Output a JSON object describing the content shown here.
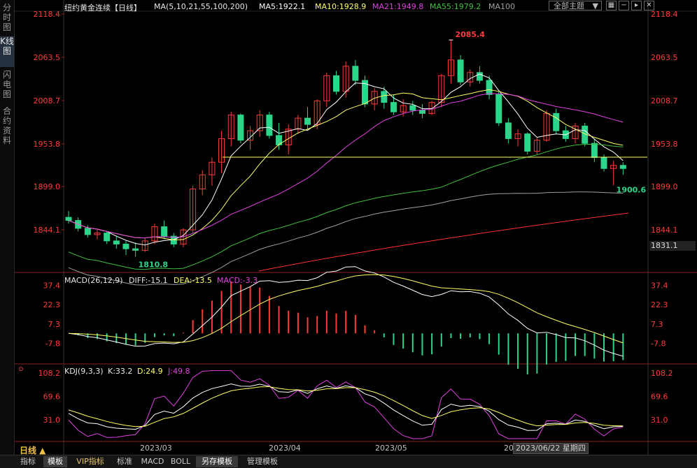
{
  "sidebar": {
    "tabs": [
      "分时图",
      "K线图",
      "闪电图",
      "合约资料"
    ],
    "active": 1
  },
  "header": {
    "title": "纽约黄金连续【日线】",
    "ma_label": "MA(5,10,21,55,100,200)",
    "ma5": "MA5:1922.1",
    "ma10": "MA10:1928.9",
    "ma21": "MA21:1949.8",
    "ma55": "MA55:1979.2",
    "ma100": "MA100",
    "theme_button": "全部主题"
  },
  "colors": {
    "up": "#ff3a3a",
    "down": "#2bd58a",
    "ma5": "#ffffff",
    "ma10": "#ffff66",
    "ma21": "#e040e0",
    "ma55": "#40c040",
    "ma100": "#a0a0a0",
    "ma200": "#ff3030",
    "axis_red": "#ff3a3a",
    "axis_green": "#2bd58a"
  },
  "price_axis": {
    "left_labels": [
      "2118.4",
      "2063.5",
      "2008.7",
      "1953.8",
      "1899.0",
      "1844.1"
    ],
    "right_labels": [
      "2118.4",
      "2063.5",
      "2008.7",
      "1953.8",
      "1899.0",
      "1844.1"
    ],
    "current_price": "1831.1"
  },
  "annotations": {
    "high": "2085.4",
    "low_march": "1810.8",
    "low_june": "1900.6"
  },
  "macd": {
    "label": "MACD(26,12,9)",
    "diff": "DIFF:-15.1",
    "dea": "DEA:-13.5",
    "macd": "MACD:-3.3",
    "labels": [
      "37.4",
      "22.3",
      "7.3",
      "-7.8"
    ]
  },
  "kdj": {
    "label": "KDJ(9,3,3)",
    "k": "K:33.2",
    "d": "D:24.9",
    "j": "J:49.8",
    "labels": [
      "108.2",
      "69.6",
      "31.0"
    ]
  },
  "x_axis": {
    "labels": [
      "2023/03",
      "2023/04",
      "2023/05",
      "20"
    ],
    "date_tip": "2023/06/22 星期四"
  },
  "period_tab": "日线 ▲",
  "bottom_tabs": [
    "指标",
    "模板",
    "VIP指标",
    "标准",
    "MACD",
    "BOLL",
    "另存模板",
    "管理模板"
  ],
  "chart_data": {
    "type": "candlestick",
    "title": "纽约黄金连续【日线】",
    "ylim": [
      1810,
      2120
    ],
    "candles_ohlc_approx": [
      [
        1860,
        1868,
        1852,
        1856
      ],
      [
        1856,
        1860,
        1842,
        1846
      ],
      [
        1846,
        1850,
        1834,
        1838
      ],
      [
        1838,
        1844,
        1832,
        1840
      ],
      [
        1840,
        1842,
        1826,
        1830
      ],
      [
        1830,
        1836,
        1820,
        1826
      ],
      [
        1826,
        1830,
        1812,
        1820
      ],
      [
        1820,
        1828,
        1810,
        1818
      ],
      [
        1818,
        1834,
        1816,
        1830
      ],
      [
        1830,
        1852,
        1826,
        1848
      ],
      [
        1848,
        1856,
        1832,
        1836
      ],
      [
        1836,
        1840,
        1822,
        1826
      ],
      [
        1826,
        1846,
        1822,
        1844
      ],
      [
        1844,
        1900,
        1840,
        1896
      ],
      [
        1896,
        1920,
        1888,
        1914
      ],
      [
        1914,
        1936,
        1900,
        1930
      ],
      [
        1930,
        1970,
        1916,
        1960
      ],
      [
        1960,
        1994,
        1950,
        1990
      ],
      [
        1990,
        1992,
        1954,
        1958
      ],
      [
        1958,
        1976,
        1946,
        1970
      ],
      [
        1970,
        1996,
        1962,
        1990
      ],
      [
        1990,
        1994,
        1960,
        1964
      ],
      [
        1964,
        1980,
        1946,
        1952
      ],
      [
        1952,
        1978,
        1940,
        1972
      ],
      [
        1972,
        1990,
        1966,
        1986
      ],
      [
        1986,
        2000,
        1972,
        1978
      ],
      [
        1978,
        2010,
        1972,
        2008
      ],
      [
        2008,
        2044,
        2000,
        2040
      ],
      [
        2040,
        2046,
        2016,
        2020
      ],
      [
        2020,
        2058,
        2012,
        2052
      ],
      [
        2052,
        2060,
        2028,
        2034
      ],
      [
        2034,
        2040,
        2000,
        2004
      ],
      [
        2004,
        2024,
        1996,
        2020
      ],
      [
        2020,
        2026,
        1998,
        2006
      ],
      [
        2006,
        2016,
        1990,
        1994
      ],
      [
        1994,
        2010,
        1988,
        2002
      ],
      [
        2002,
        2008,
        1990,
        1996
      ],
      [
        1996,
        2004,
        1986,
        1992
      ],
      [
        1992,
        2008,
        1990,
        2006
      ],
      [
        2006,
        2042,
        2000,
        2040
      ],
      [
        2040,
        2085.4,
        2030,
        2060
      ],
      [
        2060,
        2066,
        2028,
        2032
      ],
      [
        2032,
        2048,
        2026,
        2044
      ],
      [
        2044,
        2052,
        2030,
        2034
      ],
      [
        2034,
        2040,
        2010,
        2016
      ],
      [
        2016,
        2020,
        1976,
        1980
      ],
      [
        1980,
        1986,
        1954,
        1960
      ],
      [
        1960,
        1972,
        1950,
        1966
      ],
      [
        1966,
        1968,
        1940,
        1944
      ],
      [
        1944,
        1962,
        1940,
        1958
      ],
      [
        1958,
        1996,
        1956,
        1992
      ],
      [
        1992,
        1998,
        1966,
        1970
      ],
      [
        1970,
        1976,
        1956,
        1960
      ],
      [
        1960,
        1980,
        1954,
        1976
      ],
      [
        1976,
        1980,
        1950,
        1954
      ],
      [
        1954,
        1960,
        1930,
        1936
      ],
      [
        1936,
        1940,
        1918,
        1922
      ],
      [
        1922,
        1932,
        1900.6,
        1926
      ],
      [
        1926,
        1930,
        1914,
        1922
      ]
    ],
    "macd_ylim": [
      -20,
      42
    ],
    "kdj_ylim": [
      0,
      115
    ]
  }
}
